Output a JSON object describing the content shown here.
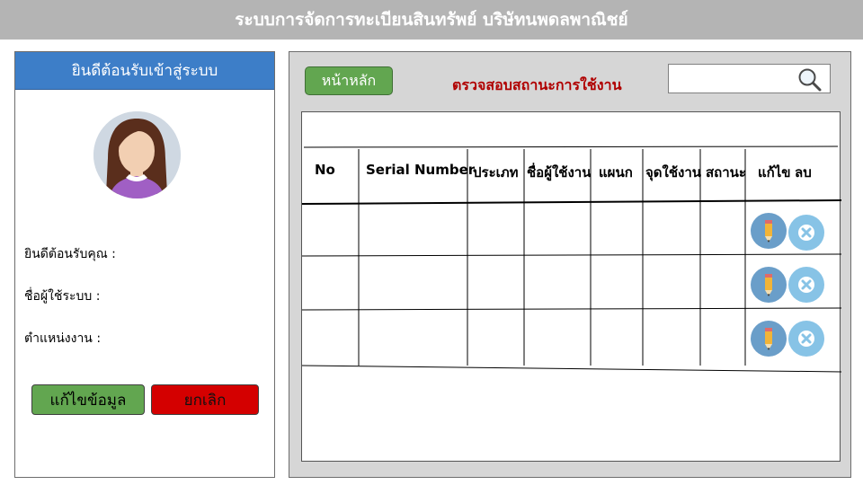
{
  "app": {
    "title": "ระบบการจัดการทะเบียนสินทรัพย์ บริษัทนพดลพาณิชย์"
  },
  "left_panel": {
    "header": "ยินดีต้อนรับเข้าสู่ระบบ",
    "welcome_label": "ยินดีต้อนรับคุณ :",
    "username_label": "ชื่อผู้ใช้ระบบ :",
    "position_label": "ตำแหน่งงาน :",
    "edit_button": "แก้ไขข้อมูล",
    "cancel_button": "ยกเลิก"
  },
  "right_panel": {
    "home_button": "หน้าหลัก",
    "status_title": "ตรวจสอบสถานะการใช้งาน",
    "search": {
      "value": "",
      "placeholder": ""
    }
  },
  "table": {
    "columns": [
      "No",
      "Serial Number",
      "ประเภท",
      "ชื่อผู้ใช้งาน",
      "แผนก",
      "จุดใช้งาน",
      "สถานะ",
      "แก้ไข",
      "ลบ"
    ],
    "rows": [
      {
        "cells": [
          "",
          "",
          "",
          "",
          "",
          "",
          ""
        ]
      },
      {
        "cells": [
          "",
          "",
          "",
          "",
          "",
          "",
          ""
        ]
      },
      {
        "cells": [
          "",
          "",
          "",
          "",
          "",
          "",
          ""
        ]
      }
    ]
  },
  "icons": {
    "search": "search-icon",
    "edit": "pencil-icon",
    "delete": "x-icon",
    "avatar": "user-avatar"
  },
  "colors": {
    "header_bar": "#b4b4b4",
    "panel_header": "#3d7ec8",
    "green_button": "#62a650",
    "red_button": "#d40000",
    "title_red": "#b00000"
  }
}
